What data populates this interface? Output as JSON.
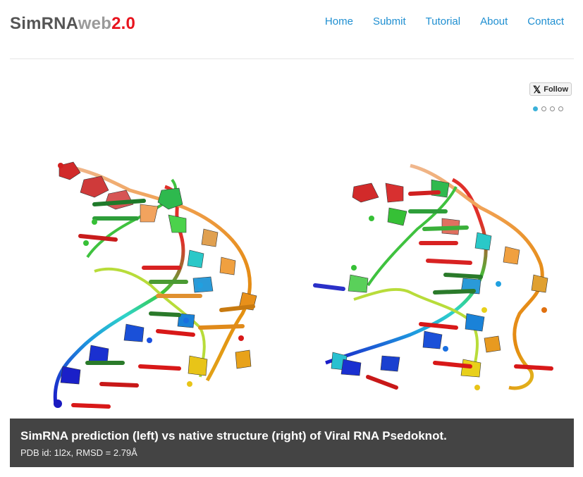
{
  "brand": {
    "part1": "SimRNA",
    "part2": "web",
    "part3": "2.0",
    "colors": {
      "dark": "#555555",
      "light": "#9a9a9a",
      "accent": "#e8141e"
    }
  },
  "nav": {
    "items": [
      "Home",
      "Submit",
      "Tutorial",
      "About",
      "Contact"
    ],
    "color": "#1f8fd1"
  },
  "social": {
    "follow_label": "Follow",
    "icon": "x-logo-icon"
  },
  "carousel": {
    "slide_count": 4,
    "active_index": 0
  },
  "slide": {
    "caption_title": "SimRNA prediction (left) vs native structure (right) of Viral RNA Psedoknot.",
    "caption_sub": "PDB id: 1l2x, RMSD = 2.79Å"
  }
}
